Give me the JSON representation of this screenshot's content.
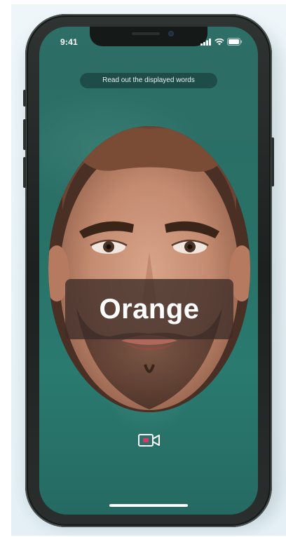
{
  "status_bar": {
    "time": "9:41",
    "icons": [
      "signal-icon",
      "wifi-icon",
      "battery-icon"
    ]
  },
  "prompt": {
    "text": "Read out the displayed words"
  },
  "word": {
    "text": "Orange"
  },
  "controls": {
    "video_icon": "video-camera-icon",
    "video_icon_dot_color": "#d9386a"
  },
  "theme": {
    "screen_bg": "#2a7a6f",
    "overlay_bg": "#3c2c28",
    "text_color": "#ffffff"
  }
}
